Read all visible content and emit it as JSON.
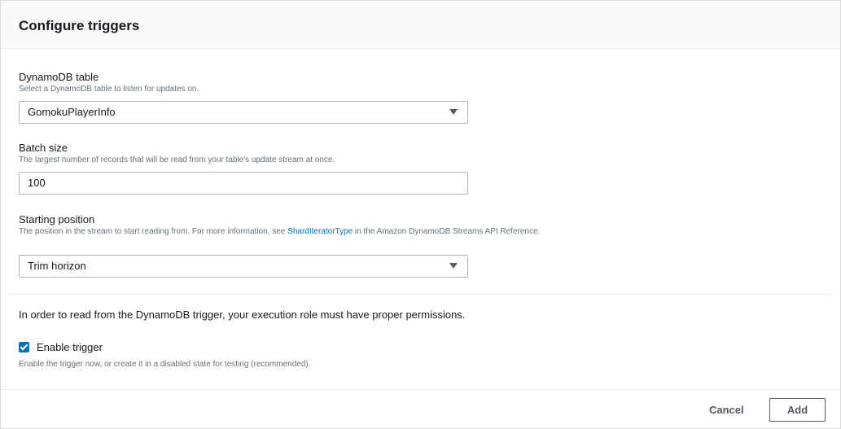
{
  "header": {
    "title": "Configure triggers"
  },
  "dynamodb_table": {
    "label": "DynamoDB table",
    "description": "Select a DynamoDB table to listen for updates on.",
    "selected": "GomokuPlayerInfo"
  },
  "batch_size": {
    "label": "Batch size",
    "description": "The largest number of records that will be read from your table's update stream at once.",
    "value": "100"
  },
  "starting_position": {
    "label": "Starting position",
    "description_before": "The position in the stream to start reading from. For more information, see ",
    "description_link": "ShardIteratorType",
    "description_after": " in the Amazon DynamoDB Streams API Reference.",
    "selected": "Trim horizon"
  },
  "permissions_note": "In order to read from the DynamoDB trigger, your execution role must have proper permissions.",
  "enable_trigger": {
    "label": "Enable trigger",
    "checked": true,
    "description": "Enable the trigger now, or create it in a disabled state for testing (recommended)."
  },
  "footer": {
    "cancel_label": "Cancel",
    "add_label": "Add"
  },
  "icons": {
    "dropdown": "caret-down-icon",
    "checkbox": "checkmark-icon"
  },
  "colors": {
    "link": "#0073bb",
    "checkbox": "#0073bb",
    "header_bg": "#fafafa"
  }
}
